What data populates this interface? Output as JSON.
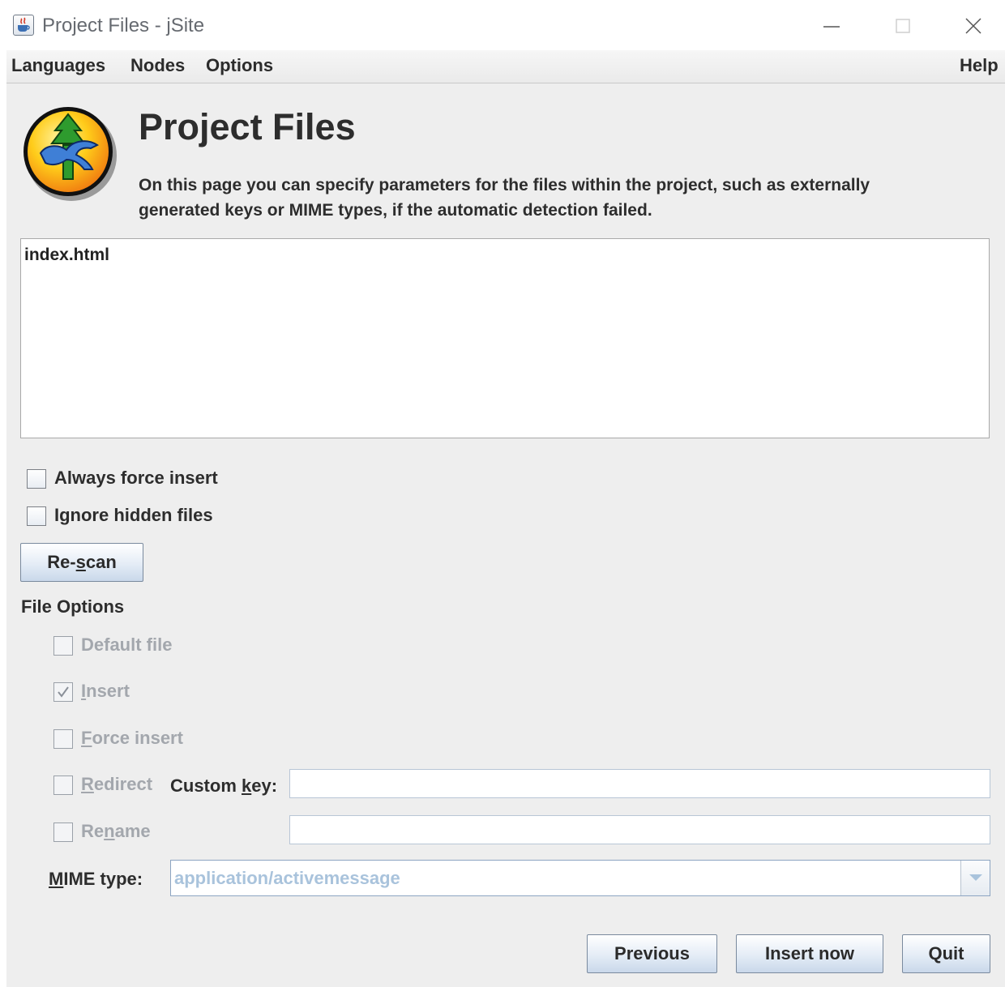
{
  "window": {
    "title": "Project Files - jSite",
    "controls": [
      "minimize-icon",
      "maximize-icon",
      "close-icon"
    ]
  },
  "menu": {
    "languages": "Languages",
    "nodes": "Nodes",
    "options": "Options",
    "help": "Help"
  },
  "header": {
    "title": "Project Files",
    "description": "On this page you can specify parameters for the files within the project, such as externally generated keys or MIME types, if the automatic detection failed."
  },
  "file_list": {
    "items": [
      "index.html"
    ]
  },
  "options": {
    "always_force_insert": {
      "label": "Always force insert",
      "checked": false
    },
    "ignore_hidden_files": {
      "label": "Ignore hidden files",
      "checked": false
    }
  },
  "rescan_button": {
    "pre": "Re-",
    "mnemonic": "s",
    "post": "can"
  },
  "file_options": {
    "section_label": "File Options",
    "default_file": {
      "label": "Default file",
      "checked": false,
      "enabled": false
    },
    "insert": {
      "mnemonic": "I",
      "rest": "nsert",
      "checked": true,
      "enabled": false
    },
    "force_insert": {
      "mnemonic": "F",
      "rest": "orce insert",
      "checked": false,
      "enabled": false
    },
    "redirect": {
      "mnemonic": "R",
      "rest": "edirect",
      "checked": false,
      "enabled": false
    },
    "custom_key": {
      "pre": "Custom ",
      "mnemonic": "k",
      "post": "ey:",
      "value": ""
    },
    "rename": {
      "pre": "Re",
      "mnemonic": "n",
      "post": "ame",
      "checked": false,
      "enabled": false,
      "value": ""
    },
    "mime_type": {
      "mnemonic": "M",
      "rest": "IME type:",
      "value": "application/activemessage"
    }
  },
  "buttons": {
    "previous": "Previous",
    "insert_now": "Insert now",
    "quit": "Quit"
  },
  "colors": {
    "panel_bg": "#eeeeee",
    "button_gradient_bottom": "#c9d8ea",
    "disabled_text": "#a3a7ad",
    "combo_value_text": "#a9c3dc"
  }
}
